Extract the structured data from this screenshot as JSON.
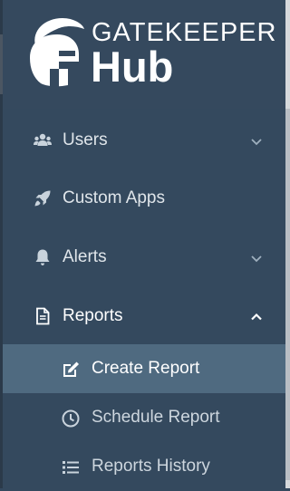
{
  "brand": {
    "name_top": "GATEKEEPER",
    "name_bottom": "Hub",
    "logo_icon": "spartan-helmet-icon"
  },
  "nav": {
    "items": [
      {
        "label": "Users",
        "icon": "users-icon",
        "has_chevron": true,
        "chevron": "chevron-down"
      },
      {
        "label": "Custom Apps",
        "icon": "rocket-icon",
        "has_chevron": false
      },
      {
        "label": "Alerts",
        "icon": "bell-icon",
        "has_chevron": true,
        "chevron": "chevron-down"
      },
      {
        "label": "Reports",
        "icon": "file-icon",
        "has_chevron": true,
        "chevron": "chevron-up",
        "expanded": true
      }
    ],
    "reports_submenu": [
      {
        "label": "Create Report",
        "icon": "edit-icon",
        "active": true
      },
      {
        "label": "Schedule Report",
        "icon": "clock-icon",
        "active": false
      },
      {
        "label": "Reports History",
        "icon": "list-icon",
        "active": false
      }
    ]
  },
  "colors": {
    "sidebar_bg": "#34495e",
    "active_bg": "#4f6a80",
    "text": "#dfe5ea",
    "icon": "#c9d3dc"
  }
}
